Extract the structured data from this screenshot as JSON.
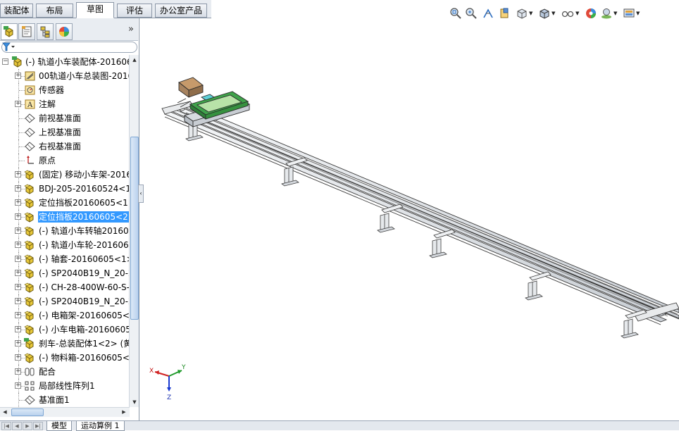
{
  "command_tabs": [
    {
      "label": "装配体",
      "active": false
    },
    {
      "label": "布局",
      "active": false
    },
    {
      "label": "草图",
      "active": true
    },
    {
      "label": "评估",
      "active": false
    },
    {
      "label": "办公室产品",
      "active": false
    }
  ],
  "view_toolbar": {
    "icons": [
      "zoom-to-fit-icon",
      "zoom-to-area-icon",
      "previous-view-icon",
      "section-view-icon",
      "view-orientation-icon",
      "display-style-icon",
      "hide-show-items-icon",
      "edit-appearance-icon",
      "apply-scene-icon",
      "view-settings-icon"
    ]
  },
  "panel": {
    "tabs": [
      "feature-manager-icon",
      "property-manager-icon",
      "configuration-manager-icon",
      "display-manager-icon"
    ],
    "collapse_label": "»"
  },
  "tree": {
    "items": [
      {
        "label": "(-) 轨道小车装配体-2016060",
        "icon": "assembly-icon"
      },
      {
        "label": "00轨道小车总装图-2016",
        "icon": "drawing-icon"
      },
      {
        "label": "传感器",
        "icon": "sensor-icon"
      },
      {
        "label": "注解",
        "icon": "annotation-icon"
      },
      {
        "label": "前视基准面",
        "icon": "plane-icon"
      },
      {
        "label": "上视基准面",
        "icon": "plane-icon"
      },
      {
        "label": "右视基准面",
        "icon": "plane-icon"
      },
      {
        "label": "原点",
        "icon": "origin-icon"
      },
      {
        "label": "(固定) 移动小车架-2016",
        "icon": "component-icon"
      },
      {
        "label": "BDJ-205-20160524<1",
        "icon": "component-icon"
      },
      {
        "label": "定位挡板20160605<1>",
        "icon": "component-icon"
      },
      {
        "label": "定位挡板20160605<2>",
        "icon": "component-icon",
        "selected": true
      },
      {
        "label": "(-) 轨道小车转轴20160",
        "icon": "component-icon"
      },
      {
        "label": "(-) 轨道小车轮-2016060",
        "icon": "component-icon"
      },
      {
        "label": "(-) 轴套-20160605<1>",
        "icon": "component-icon"
      },
      {
        "label": "(-) SP2040B19_N_20-2",
        "icon": "component-icon"
      },
      {
        "label": "(-) CH-28-400W-60-S-",
        "icon": "component-icon"
      },
      {
        "label": "(-) SP2040B19_N_20-2",
        "icon": "component-icon"
      },
      {
        "label": "(-) 电箱架-20160605<1",
        "icon": "component-icon"
      },
      {
        "label": "(-) 小车电箱-20160605",
        "icon": "component-icon"
      },
      {
        "label": "刹车-总装配体1<2> (黄",
        "icon": "subassembly-icon"
      },
      {
        "label": "(-) 物料箱-20160605<1",
        "icon": "component-icon"
      },
      {
        "label": "配合",
        "icon": "mates-icon"
      },
      {
        "label": "局部线性阵列1",
        "icon": "linear-pattern-icon"
      },
      {
        "label": "基准面1",
        "icon": "plane-icon"
      }
    ]
  },
  "triad": {
    "x": "X",
    "y": "Y",
    "z": "Z"
  },
  "bottom_tabs": [
    "模型",
    "运动算例 1"
  ],
  "colors": {
    "selection": "#3399ff",
    "tray_green": "#3fa24a",
    "box_brown": "#a7835f"
  }
}
